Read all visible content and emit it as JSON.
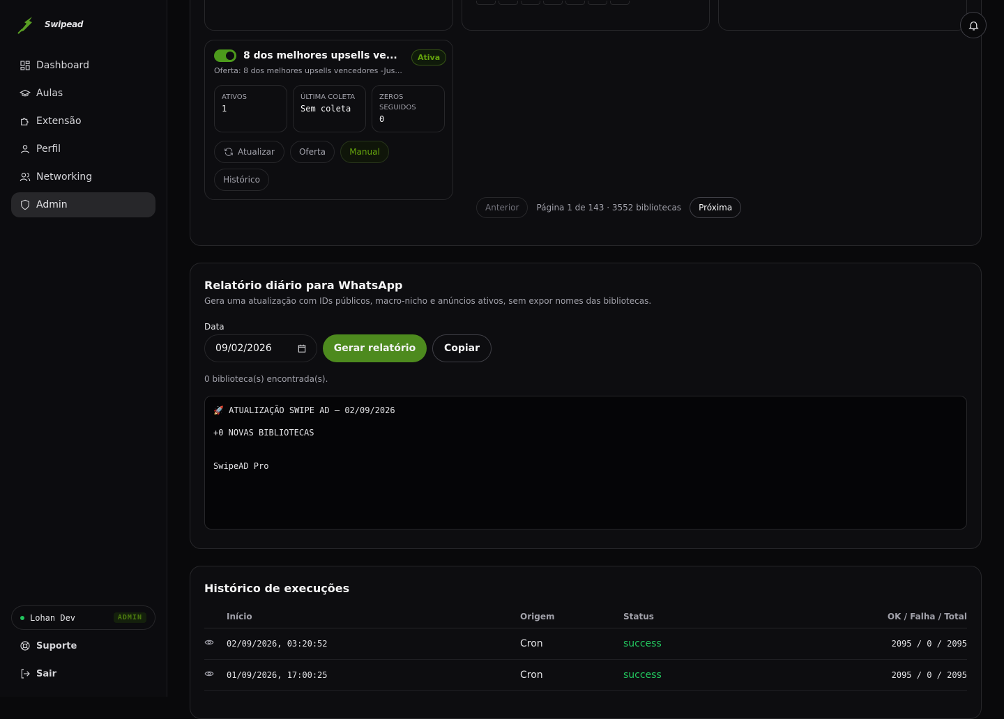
{
  "brand": {
    "name": "Swipead"
  },
  "nav": {
    "items": [
      {
        "label": "Dashboard"
      },
      {
        "label": "Aulas"
      },
      {
        "label": "Extensão"
      },
      {
        "label": "Perfil"
      },
      {
        "label": "Networking"
      },
      {
        "label": "Admin"
      }
    ]
  },
  "user": {
    "name": "Lohan Dev",
    "role_badge": "ADMIN"
  },
  "footer_links": {
    "support": "Suporte",
    "logout": "Sair"
  },
  "library_card": {
    "title": "8 dos melhores upsells ve...",
    "status": "Ativa",
    "offer": "Oferta: 8 dos melhores upsells vencedores -Jus...",
    "stats": [
      {
        "label": "ATIVOS",
        "value": "1"
      },
      {
        "label": "ÚLTIMA COLETA",
        "value": "Sem coleta"
      },
      {
        "label": "ZEROS SEGUIDOS",
        "value": "0"
      }
    ],
    "actions": {
      "refresh": "Atualizar",
      "offer": "Oferta",
      "manual": "Manual",
      "history": "Histórico"
    }
  },
  "pagination": {
    "prev": "Anterior",
    "info": "Página 1 de 143 · 3552 bibliotecas",
    "next": "Próxima"
  },
  "report": {
    "title": "Relatório diário para WhatsApp",
    "description": "Gera uma atualização com IDs públicos, macro-nicho e anúncios ativos, sem expor nomes das bibliotecas.",
    "date_label": "Data",
    "date_value": "09/02/2026",
    "generate_label": "Gerar relatório",
    "copy_label": "Copiar",
    "found_text": "0 biblioteca(s) encontrada(s).",
    "output": {
      "line1": "🚀 ATUALIZAÇÃO SWIPE AD — 02/09/2026",
      "line2": "+0 NOVAS BIBLIOTECAS",
      "line3": "SwipeAD Pro"
    }
  },
  "history": {
    "title": "Histórico de execuções",
    "columns": {
      "start": "Início",
      "origin": "Origem",
      "status": "Status",
      "totals": "OK / Falha / Total"
    },
    "rows": [
      {
        "start": "02/09/2026, 03:20:52",
        "origin": "Cron",
        "status": "success",
        "totals": "2095 / 0 / 2095"
      },
      {
        "start": "01/09/2026, 17:00:25",
        "origin": "Cron",
        "status": "success",
        "totals": "2095 / 0 / 2095"
      }
    ]
  },
  "colors": {
    "accent": "#4d8a1e",
    "success": "#22c55e",
    "background": "#09090b"
  }
}
